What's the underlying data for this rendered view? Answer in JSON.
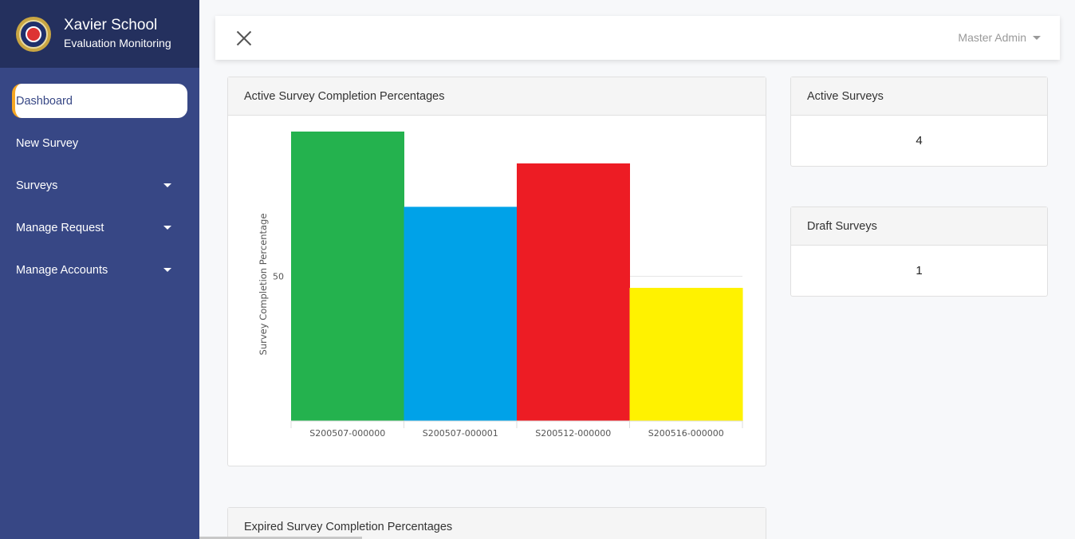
{
  "brand": {
    "title": "Xavier School",
    "subtitle": "Evaluation Monitoring",
    "logo_icon": "school-seal-icon"
  },
  "sidebar": {
    "items": [
      {
        "label": "Dashboard",
        "active": true,
        "has_caret": false
      },
      {
        "label": "New Survey",
        "active": false,
        "has_caret": false
      },
      {
        "label": "Surveys",
        "active": false,
        "has_caret": true
      },
      {
        "label": "Manage Request",
        "active": false,
        "has_caret": true
      },
      {
        "label": "Manage Accounts",
        "active": false,
        "has_caret": true
      }
    ]
  },
  "topbar": {
    "user": "Master Admin"
  },
  "cards": {
    "completion_title": "Active Survey Completion Percentages",
    "expired_title": "Expired Survey Completion Percentages",
    "active_surveys": {
      "title": "Active Surveys",
      "value": "4"
    },
    "draft_surveys": {
      "title": "Draft Surveys",
      "value": "1"
    }
  },
  "chart_data": {
    "type": "bar",
    "categories": [
      "S200507-000000",
      "S200507-000001",
      "S200512-000000",
      "S200516-000000"
    ],
    "values": [
      100,
      74,
      89,
      46
    ],
    "colors": [
      "#24b24e",
      "#00a2e8",
      "#ed1c24",
      "#fff200"
    ],
    "ylabel": "Survey Completion Percentage",
    "yticks": [
      50
    ],
    "ylim": [
      0,
      100
    ],
    "grid": true
  }
}
